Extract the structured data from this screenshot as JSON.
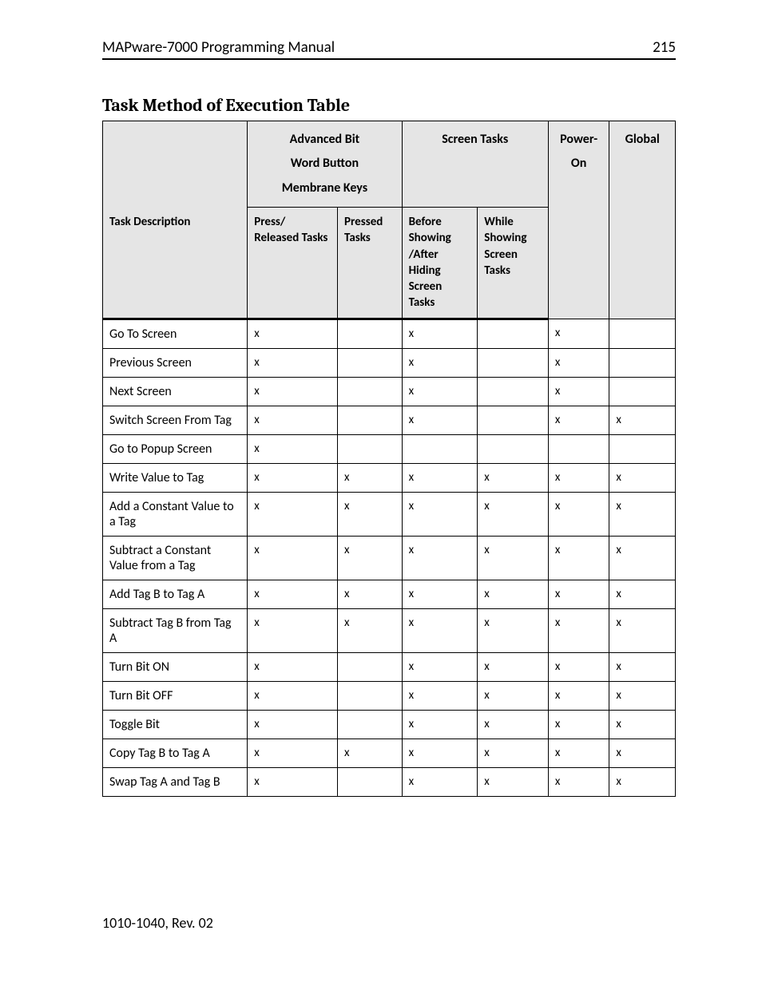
{
  "header": {
    "doc_title": "MAPware-7000 Programming Manual",
    "page_number": "215"
  },
  "section_title": "Task Method of Execution Table",
  "columns": {
    "desc_label": "Task Description",
    "group_advanced": "Advanced Bit\nWord Button\nMembrane Keys",
    "group_screen": "Screen Tasks",
    "group_poweron": "Power-On",
    "group_global": "Global",
    "sub_press_released": "Press/ Released Tasks",
    "sub_pressed_tasks": "Pressed Tasks",
    "sub_before_after": "Before Showing /After Hiding Screen Tasks",
    "sub_while_showing": "While Showing Screen Tasks"
  },
  "mark": "x",
  "rows": [
    {
      "desc": "Go To Screen",
      "c": [
        "x",
        "",
        "x",
        "",
        "x",
        ""
      ]
    },
    {
      "desc": "Previous Screen",
      "c": [
        "x",
        "",
        "x",
        "",
        "x",
        ""
      ]
    },
    {
      "desc": "Next Screen",
      "c": [
        "x",
        "",
        "x",
        "",
        "x",
        ""
      ]
    },
    {
      "desc": "Switch Screen From Tag",
      "c": [
        "x",
        "",
        "x",
        "",
        "x",
        "x"
      ]
    },
    {
      "desc": "Go to Popup Screen",
      "c": [
        "x",
        "",
        "",
        "",
        "",
        ""
      ]
    },
    {
      "desc": "Write Value to Tag",
      "c": [
        "x",
        "x",
        "x",
        "x",
        "x",
        "x"
      ]
    },
    {
      "desc": "Add a Constant Value to a Tag",
      "c": [
        "x",
        "x",
        "x",
        "x",
        "x",
        "x"
      ]
    },
    {
      "desc": "Subtract a Constant Value from a Tag",
      "c": [
        "x",
        "x",
        "x",
        "x",
        "x",
        "x"
      ]
    },
    {
      "desc": "Add Tag B to Tag A",
      "c": [
        "x",
        "x",
        "x",
        "x",
        "x",
        "x"
      ]
    },
    {
      "desc": "Subtract Tag B from Tag A",
      "c": [
        "x",
        "x",
        "x",
        "x",
        "x",
        "x"
      ]
    },
    {
      "desc": "Turn Bit ON",
      "c": [
        "x",
        "",
        "x",
        "x",
        "x",
        "x"
      ]
    },
    {
      "desc": "Turn Bit OFF",
      "c": [
        "x",
        "",
        "x",
        "x",
        "x",
        "x"
      ]
    },
    {
      "desc": "Toggle Bit",
      "c": [
        "x",
        "",
        "x",
        "x",
        "x",
        "x"
      ]
    },
    {
      "desc": "Copy Tag B to Tag A",
      "c": [
        "x",
        "x",
        "x",
        "x",
        "x",
        "x"
      ]
    },
    {
      "desc": "Swap Tag A and Tag B",
      "c": [
        "x",
        "",
        "x",
        "x",
        "x",
        "x"
      ]
    }
  ],
  "footer": "1010-1040, Rev. 02",
  "chart_data": {
    "type": "table",
    "title": "Task Method of Execution Table",
    "columns": [
      "Task Description",
      "Advanced Bit / Word Button / Membrane Keys — Press/Released Tasks",
      "Advanced Bit / Word Button / Membrane Keys — Pressed Tasks",
      "Screen Tasks — Before Showing / After Hiding Screen Tasks",
      "Screen Tasks — While Showing Screen Tasks",
      "Power-On",
      "Global"
    ],
    "rows": [
      [
        "Go To Screen",
        true,
        false,
        true,
        false,
        true,
        false
      ],
      [
        "Previous Screen",
        true,
        false,
        true,
        false,
        true,
        false
      ],
      [
        "Next Screen",
        true,
        false,
        true,
        false,
        true,
        false
      ],
      [
        "Switch Screen From Tag",
        true,
        false,
        true,
        false,
        true,
        true
      ],
      [
        "Go to Popup Screen",
        true,
        false,
        false,
        false,
        false,
        false
      ],
      [
        "Write Value to Tag",
        true,
        true,
        true,
        true,
        true,
        true
      ],
      [
        "Add a Constant Value to a Tag",
        true,
        true,
        true,
        true,
        true,
        true
      ],
      [
        "Subtract a Constant Value from a Tag",
        true,
        true,
        true,
        true,
        true,
        true
      ],
      [
        "Add Tag B to Tag A",
        true,
        true,
        true,
        true,
        true,
        true
      ],
      [
        "Subtract Tag B from Tag A",
        true,
        true,
        true,
        true,
        true,
        true
      ],
      [
        "Turn Bit ON",
        true,
        false,
        true,
        true,
        true,
        true
      ],
      [
        "Turn Bit OFF",
        true,
        false,
        true,
        true,
        true,
        true
      ],
      [
        "Toggle Bit",
        true,
        false,
        true,
        true,
        true,
        true
      ],
      [
        "Copy Tag B to Tag A",
        true,
        true,
        true,
        true,
        true,
        true
      ],
      [
        "Swap Tag A and Tag B",
        true,
        false,
        true,
        true,
        true,
        true
      ]
    ]
  }
}
